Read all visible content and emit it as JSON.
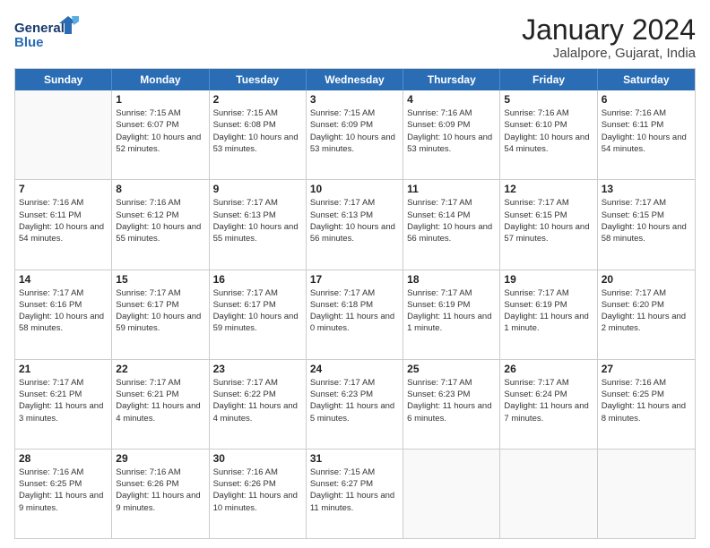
{
  "header": {
    "logo_line1": "General",
    "logo_line2": "Blue",
    "month": "January 2024",
    "location": "Jalalpore, Gujarat, India"
  },
  "days_of_week": [
    "Sunday",
    "Monday",
    "Tuesday",
    "Wednesday",
    "Thursday",
    "Friday",
    "Saturday"
  ],
  "weeks": [
    [
      {
        "day": "",
        "empty": true
      },
      {
        "day": "1",
        "sunrise": "7:15 AM",
        "sunset": "6:07 PM",
        "daylight": "10 hours and 52 minutes."
      },
      {
        "day": "2",
        "sunrise": "7:15 AM",
        "sunset": "6:08 PM",
        "daylight": "10 hours and 53 minutes."
      },
      {
        "day": "3",
        "sunrise": "7:15 AM",
        "sunset": "6:09 PM",
        "daylight": "10 hours and 53 minutes."
      },
      {
        "day": "4",
        "sunrise": "7:16 AM",
        "sunset": "6:09 PM",
        "daylight": "10 hours and 53 minutes."
      },
      {
        "day": "5",
        "sunrise": "7:16 AM",
        "sunset": "6:10 PM",
        "daylight": "10 hours and 54 minutes."
      },
      {
        "day": "6",
        "sunrise": "7:16 AM",
        "sunset": "6:11 PM",
        "daylight": "10 hours and 54 minutes."
      }
    ],
    [
      {
        "day": "7",
        "sunrise": "7:16 AM",
        "sunset": "6:11 PM",
        "daylight": "10 hours and 54 minutes."
      },
      {
        "day": "8",
        "sunrise": "7:16 AM",
        "sunset": "6:12 PM",
        "daylight": "10 hours and 55 minutes."
      },
      {
        "day": "9",
        "sunrise": "7:17 AM",
        "sunset": "6:13 PM",
        "daylight": "10 hours and 55 minutes."
      },
      {
        "day": "10",
        "sunrise": "7:17 AM",
        "sunset": "6:13 PM",
        "daylight": "10 hours and 56 minutes."
      },
      {
        "day": "11",
        "sunrise": "7:17 AM",
        "sunset": "6:14 PM",
        "daylight": "10 hours and 56 minutes."
      },
      {
        "day": "12",
        "sunrise": "7:17 AM",
        "sunset": "6:15 PM",
        "daylight": "10 hours and 57 minutes."
      },
      {
        "day": "13",
        "sunrise": "7:17 AM",
        "sunset": "6:15 PM",
        "daylight": "10 hours and 58 minutes."
      }
    ],
    [
      {
        "day": "14",
        "sunrise": "7:17 AM",
        "sunset": "6:16 PM",
        "daylight": "10 hours and 58 minutes."
      },
      {
        "day": "15",
        "sunrise": "7:17 AM",
        "sunset": "6:17 PM",
        "daylight": "10 hours and 59 minutes."
      },
      {
        "day": "16",
        "sunrise": "7:17 AM",
        "sunset": "6:17 PM",
        "daylight": "10 hours and 59 minutes."
      },
      {
        "day": "17",
        "sunrise": "7:17 AM",
        "sunset": "6:18 PM",
        "daylight": "11 hours and 0 minutes."
      },
      {
        "day": "18",
        "sunrise": "7:17 AM",
        "sunset": "6:19 PM",
        "daylight": "11 hours and 1 minute."
      },
      {
        "day": "19",
        "sunrise": "7:17 AM",
        "sunset": "6:19 PM",
        "daylight": "11 hours and 1 minute."
      },
      {
        "day": "20",
        "sunrise": "7:17 AM",
        "sunset": "6:20 PM",
        "daylight": "11 hours and 2 minutes."
      }
    ],
    [
      {
        "day": "21",
        "sunrise": "7:17 AM",
        "sunset": "6:21 PM",
        "daylight": "11 hours and 3 minutes."
      },
      {
        "day": "22",
        "sunrise": "7:17 AM",
        "sunset": "6:21 PM",
        "daylight": "11 hours and 4 minutes."
      },
      {
        "day": "23",
        "sunrise": "7:17 AM",
        "sunset": "6:22 PM",
        "daylight": "11 hours and 4 minutes."
      },
      {
        "day": "24",
        "sunrise": "7:17 AM",
        "sunset": "6:23 PM",
        "daylight": "11 hours and 5 minutes."
      },
      {
        "day": "25",
        "sunrise": "7:17 AM",
        "sunset": "6:23 PM",
        "daylight": "11 hours and 6 minutes."
      },
      {
        "day": "26",
        "sunrise": "7:17 AM",
        "sunset": "6:24 PM",
        "daylight": "11 hours and 7 minutes."
      },
      {
        "day": "27",
        "sunrise": "7:16 AM",
        "sunset": "6:25 PM",
        "daylight": "11 hours and 8 minutes."
      }
    ],
    [
      {
        "day": "28",
        "sunrise": "7:16 AM",
        "sunset": "6:25 PM",
        "daylight": "11 hours and 9 minutes."
      },
      {
        "day": "29",
        "sunrise": "7:16 AM",
        "sunset": "6:26 PM",
        "daylight": "11 hours and 9 minutes."
      },
      {
        "day": "30",
        "sunrise": "7:16 AM",
        "sunset": "6:26 PM",
        "daylight": "11 hours and 10 minutes."
      },
      {
        "day": "31",
        "sunrise": "7:15 AM",
        "sunset": "6:27 PM",
        "daylight": "11 hours and 11 minutes."
      },
      {
        "day": "",
        "empty": true
      },
      {
        "day": "",
        "empty": true
      },
      {
        "day": "",
        "empty": true
      }
    ]
  ]
}
